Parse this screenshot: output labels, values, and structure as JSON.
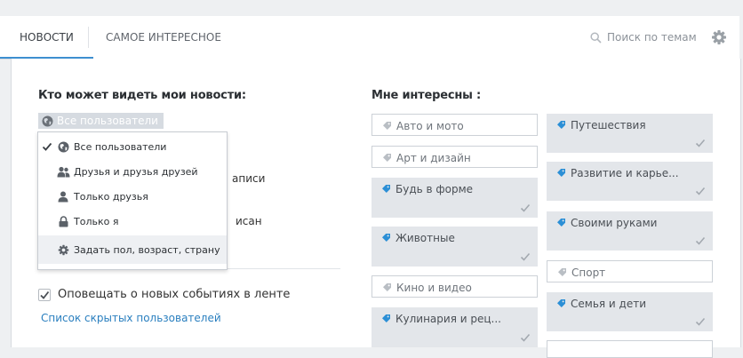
{
  "tabs": [
    {
      "label": "НОВОСТИ",
      "active": true
    },
    {
      "label": "САМОЕ ИНТЕРЕСНОЕ",
      "active": false
    }
  ],
  "search": {
    "placeholder": "Поиск по темам"
  },
  "privacy": {
    "heading": "Кто может видеть мои новости:",
    "selected": "Все пользователи",
    "options": [
      {
        "label": "Все пользователи",
        "icon": "globe-icon",
        "checked": true
      },
      {
        "label": "Друзья и друзья друзей",
        "icon": "users-icon",
        "checked": false
      },
      {
        "label": "Только друзья",
        "icon": "user-icon",
        "checked": false
      },
      {
        "label": "Только я",
        "icon": "lock-icon",
        "checked": false
      },
      {
        "label": "Задать пол, возраст, страну",
        "icon": "gear-icon",
        "checked": false
      }
    ],
    "obscured_text_1": "аписи",
    "obscured_text_2": "исан"
  },
  "notify": {
    "label": "Оповещать о новых событиях в ленте",
    "checked": true
  },
  "hidden_users_link": "Список скрытых пользователей",
  "interests": {
    "heading": "Мне интересны :",
    "left": [
      {
        "label": "Авто и мото",
        "selected": false
      },
      {
        "label": "Арт и дизайн",
        "selected": false
      },
      {
        "label": "Будь в форме",
        "selected": true
      },
      {
        "label": "Животные",
        "selected": true
      },
      {
        "label": "Кино и видео",
        "selected": false
      },
      {
        "label": "Кулинария и рец...",
        "selected": true
      }
    ],
    "right": [
      {
        "label": "Путешествия",
        "selected": true
      },
      {
        "label": "Развитие и карье...",
        "selected": true
      },
      {
        "label": "Своими руками",
        "selected": true
      },
      {
        "label": "Спорт",
        "selected": false
      },
      {
        "label": "Семья и дети",
        "selected": true
      }
    ]
  },
  "colors": {
    "accent": "#3d8fd0",
    "tag_selected": "#2b8fd6",
    "tag_plain": "#b9bec4",
    "link": "#2a7fbf"
  }
}
